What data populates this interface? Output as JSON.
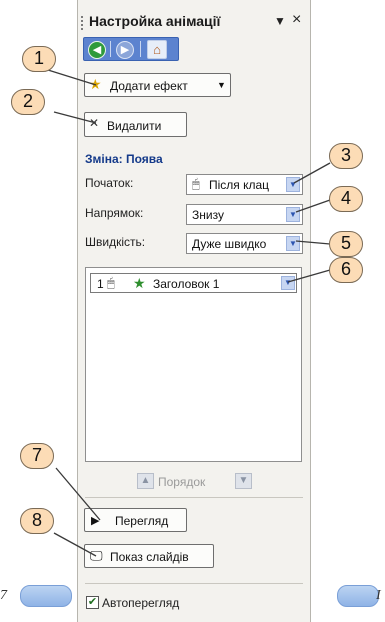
{
  "pane": {
    "title": "Настройка анімації",
    "close_glyph": "×",
    "menu_glyph": "▼"
  },
  "nav": {
    "back_icon": "back-arrow-icon",
    "forward_icon": "forward-arrow-icon",
    "home_icon": "home-icon"
  },
  "buttons": {
    "add_effect": "Додати ефект",
    "remove": "Видалити",
    "preview": "Перегляд",
    "slideshow": "Показ слайдів"
  },
  "section": {
    "heading": "Зміна: Поява",
    "start_label": "Початок:",
    "start_value": "Після клац",
    "direction_label": "Напрямок:",
    "direction_value": "Знизу",
    "speed_label": "Швидкість:",
    "speed_value": "Дуже швидко"
  },
  "list": {
    "items": [
      {
        "number": "1",
        "name": "Заголовок 1"
      }
    ]
  },
  "order": {
    "label": "Порядок"
  },
  "autopreview": {
    "label": "Автоперегляд",
    "checked": true
  },
  "callouts": [
    "1",
    "2",
    "3",
    "4",
    "5",
    "6",
    "7",
    "8"
  ],
  "edge_text": {
    "left": "7",
    "right": "I"
  },
  "colors": {
    "pane_bg": "#f3f2ee",
    "nav_bar": "#5c83cf",
    "callout_fill": "#fcdcb6"
  }
}
